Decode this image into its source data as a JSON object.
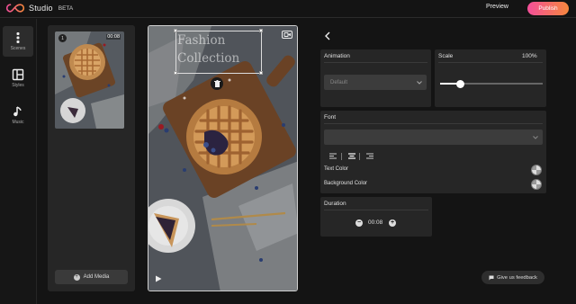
{
  "app": {
    "name": "Studio",
    "badge": "BETA"
  },
  "header": {
    "preview_label": "Preview",
    "publish_label": "Publish"
  },
  "nav": {
    "items": [
      {
        "label": "Scenes",
        "icon": "scenes-icon",
        "active": true
      },
      {
        "label": "Styles",
        "icon": "layout-icon",
        "active": false
      },
      {
        "label": "Music",
        "icon": "music-note-icon",
        "active": false
      }
    ]
  },
  "scenes": {
    "items": [
      {
        "index": "1",
        "duration": "00:08",
        "thumbnail": "berry-pie-photo"
      }
    ],
    "add_media_label": "Add Media"
  },
  "canvas": {
    "overlay_text_line1": "Fashion",
    "overlay_text_line2": "Collection"
  },
  "properties": {
    "animation": {
      "title": "Animation",
      "value": "Default"
    },
    "scale": {
      "title": "Scale",
      "value": "100%",
      "slider_fraction": 0.2
    },
    "font": {
      "title": "Font",
      "value": "",
      "text_color_label": "Text Color",
      "background_color_label": "Background Color"
    },
    "duration": {
      "title": "Duration",
      "value": "00:08"
    }
  },
  "feedback_label": "Give us feedback",
  "colors": {
    "publish_gradient_start": "#f44f9a",
    "publish_gradient_end": "#f6873d",
    "panel": "#262626",
    "background": "#141414"
  }
}
